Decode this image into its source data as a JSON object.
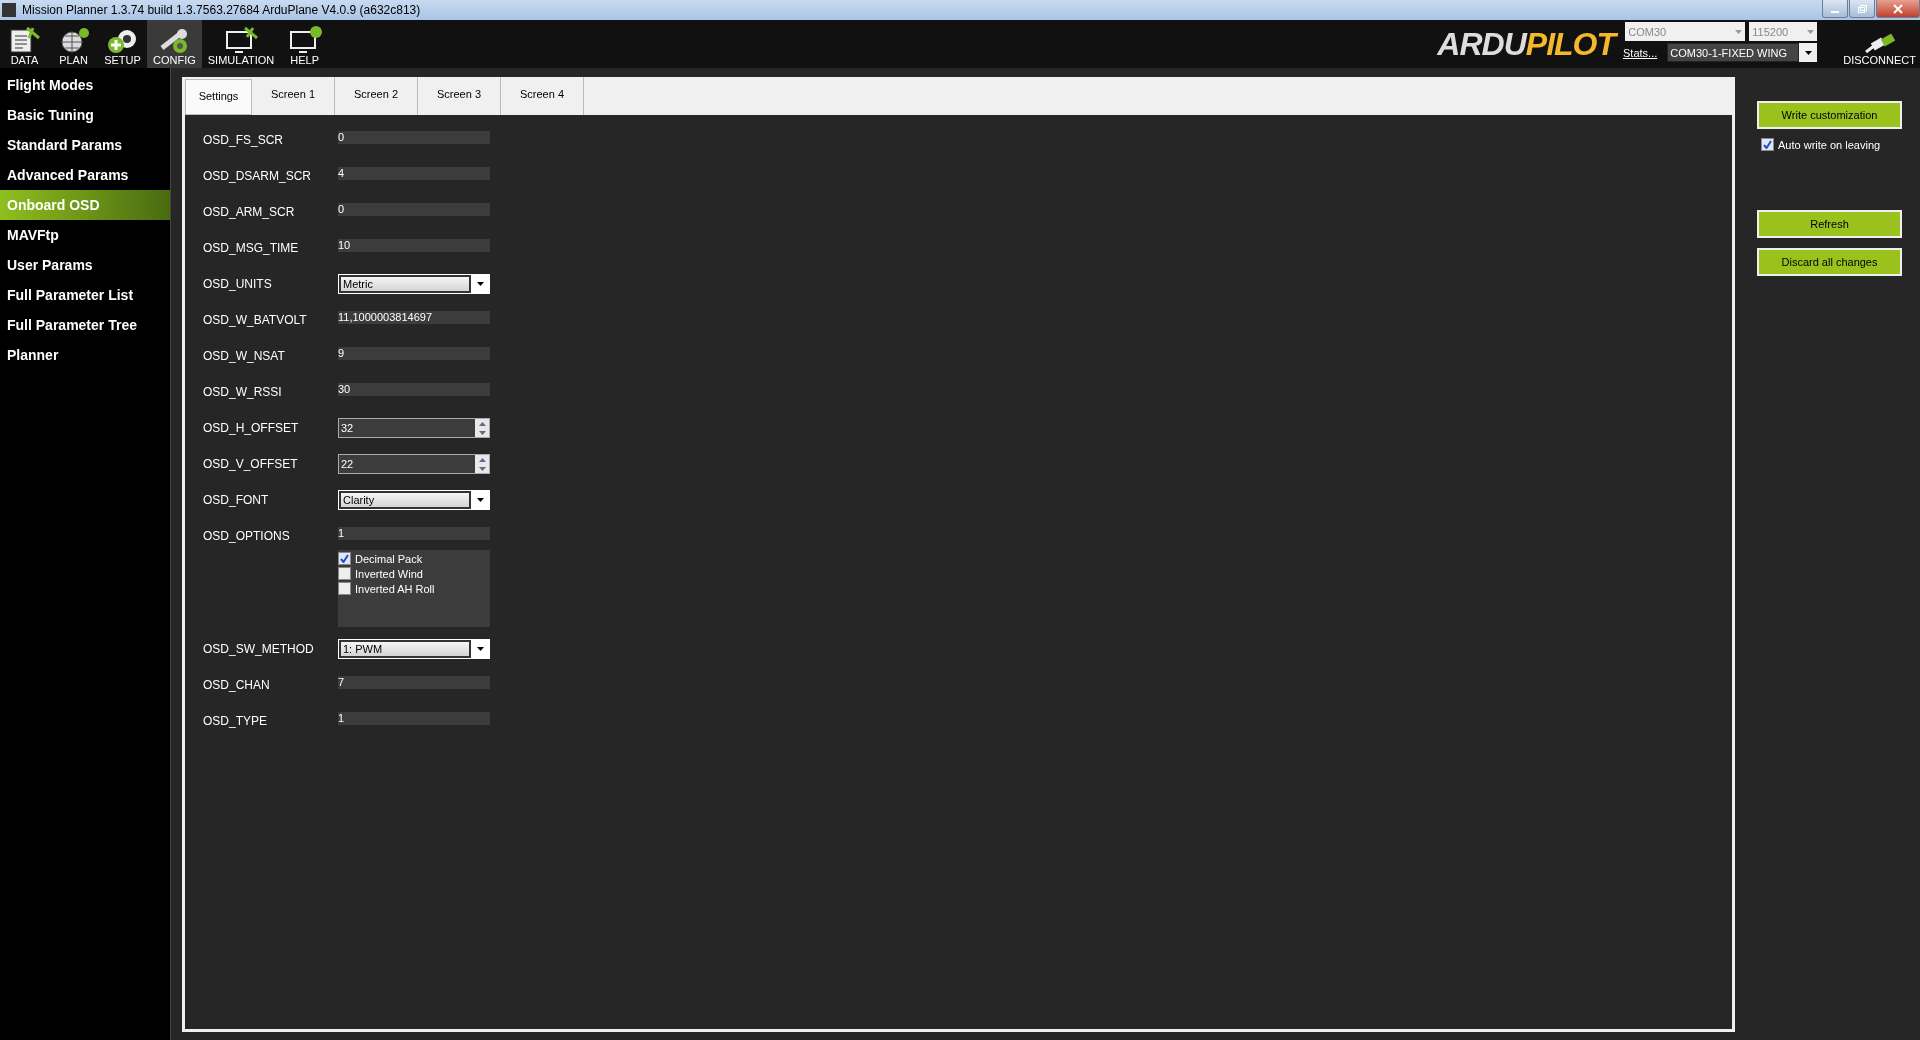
{
  "window": {
    "title": "Mission Planner 1.3.74 build 1.3.7563.27684 ArduPlane V4.0.9 (a632c813)"
  },
  "toolbar": [
    {
      "label": "DATA",
      "kind": "data",
      "selected": false
    },
    {
      "label": "PLAN",
      "kind": "plan",
      "selected": false
    },
    {
      "label": "SETUP",
      "kind": "setup",
      "selected": false
    },
    {
      "label": "CONFIG",
      "kind": "config",
      "selected": true
    },
    {
      "label": "SIMULATION",
      "kind": "simulation",
      "selected": false
    },
    {
      "label": "HELP",
      "kind": "help",
      "selected": false
    }
  ],
  "logo": {
    "part_1": "ARDU",
    "part_2": "PILOT"
  },
  "connection": {
    "port": "COM30",
    "baud": "115200",
    "stats_link": "Stats...",
    "vehicle": "COM30-1-FIXED WING",
    "disconnect": "DISCONNECT"
  },
  "sidebar": {
    "items": [
      {
        "label": "Flight Modes",
        "selected": false
      },
      {
        "label": "Basic Tuning",
        "selected": false
      },
      {
        "label": "Standard Params",
        "selected": false
      },
      {
        "label": "Advanced Params",
        "selected": false
      },
      {
        "label": "Onboard OSD",
        "selected": true
      },
      {
        "label": "MAVFtp",
        "selected": false
      },
      {
        "label": "User Params",
        "selected": false
      },
      {
        "label": "Full Parameter List",
        "selected": false
      },
      {
        "label": "Full Parameter Tree",
        "selected": false
      },
      {
        "label": "Planner",
        "selected": false
      }
    ]
  },
  "tabs": [
    {
      "label": "Settings",
      "selected": true
    },
    {
      "label": "Screen 1",
      "selected": false
    },
    {
      "label": "Screen 2",
      "selected": false
    },
    {
      "label": "Screen 3",
      "selected": false
    },
    {
      "label": "Screen 4",
      "selected": false
    }
  ],
  "params": [
    {
      "name": "OSD_FS_SCR",
      "kind": "text",
      "value": "0"
    },
    {
      "name": "OSD_DSARM_SCR",
      "kind": "text",
      "value": "4"
    },
    {
      "name": "OSD_ARM_SCR",
      "kind": "text",
      "value": "0"
    },
    {
      "name": "OSD_MSG_TIME",
      "kind": "text",
      "value": "10"
    },
    {
      "name": "OSD_UNITS",
      "kind": "combo",
      "value": "Metric"
    },
    {
      "name": "OSD_W_BATVOLT",
      "kind": "text",
      "value": "11,1000003814697"
    },
    {
      "name": "OSD_W_NSAT",
      "kind": "text",
      "value": "9"
    },
    {
      "name": "OSD_W_RSSI",
      "kind": "text",
      "value": "30"
    },
    {
      "name": "OSD_H_OFFSET",
      "kind": "spin",
      "value": "32"
    },
    {
      "name": "OSD_V_OFFSET",
      "kind": "spin",
      "value": "22"
    },
    {
      "name": "OSD_FONT",
      "kind": "combo",
      "value": "Clarity"
    },
    {
      "name": "OSD_OPTIONS",
      "kind": "bitmask",
      "value": "1",
      "options": [
        {
          "label": "Decimal Pack",
          "checked": true
        },
        {
          "label": "Inverted Wind",
          "checked": false
        },
        {
          "label": "Inverted AH Roll",
          "checked": false
        }
      ]
    },
    {
      "name": "OSD_SW_METHOD",
      "kind": "combo",
      "value": "1: PWM"
    },
    {
      "name": "OSD_CHAN",
      "kind": "text",
      "value": "7"
    },
    {
      "name": "OSD_TYPE",
      "kind": "text",
      "value": "1"
    }
  ],
  "actions": {
    "write": "Write customization",
    "auto_write": {
      "label": "Auto write on leaving",
      "checked": true
    },
    "refresh": "Refresh",
    "discard": "Discard all changes"
  }
}
